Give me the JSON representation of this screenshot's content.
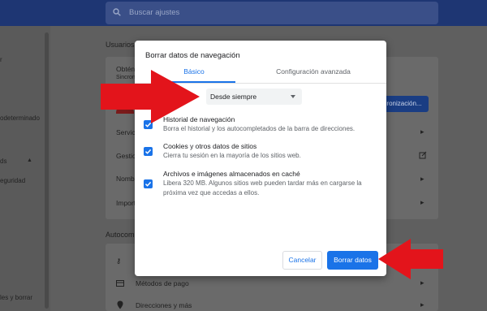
{
  "search": {
    "placeholder": "Buscar ajustes"
  },
  "leftnav": {
    "items": [
      {
        "label": "r"
      },
      {
        "label": "odeterminado"
      },
      {
        "label": "ds"
      },
      {
        "label": "eguridad"
      },
      {
        "label": "les y borrar"
      }
    ]
  },
  "background": {
    "section_users": "Usuarios",
    "sync_title": "Obtén",
    "sync_sub": "Sincron",
    "sync_button": "ronización...",
    "rows": [
      {
        "label": "Servicio"
      },
      {
        "label": "Gestion"
      },
      {
        "label": "Nombre"
      },
      {
        "label": "Import"
      }
    ],
    "section_autofill": "Autocom",
    "autofill_rows": [
      {
        "label": "Métodos de pago"
      },
      {
        "label": "Direcciones y más"
      }
    ]
  },
  "dialog": {
    "title": "Borrar datos de navegación",
    "tabs": [
      {
        "label": "Básico",
        "active": true
      },
      {
        "label": "Configuración avanzada",
        "active": false
      }
    ],
    "range_label": "o",
    "range_value": "Desde siempre",
    "items": [
      {
        "title": "Historial de navegación",
        "desc": "Borra el historial y los autocompletados de la barra de direcciones.",
        "checked": true
      },
      {
        "title": "Cookies y otros datos de sitios",
        "desc": "Cierra tu sesión en la mayoría de los sitios web.",
        "checked": true
      },
      {
        "title": "Archivos e imágenes almacenados en caché",
        "desc": "Libera 320 MB. Algunos sitios web pueden tardar más en cargarse la próxima vez que accedas a ellos.",
        "checked": true
      }
    ],
    "cancel_label": "Cancelar",
    "clear_label": "Borrar datos"
  },
  "colors": {
    "accent": "#1a73e8",
    "annotation_arrow": "#e3141b",
    "topbar": "#1e3673"
  }
}
